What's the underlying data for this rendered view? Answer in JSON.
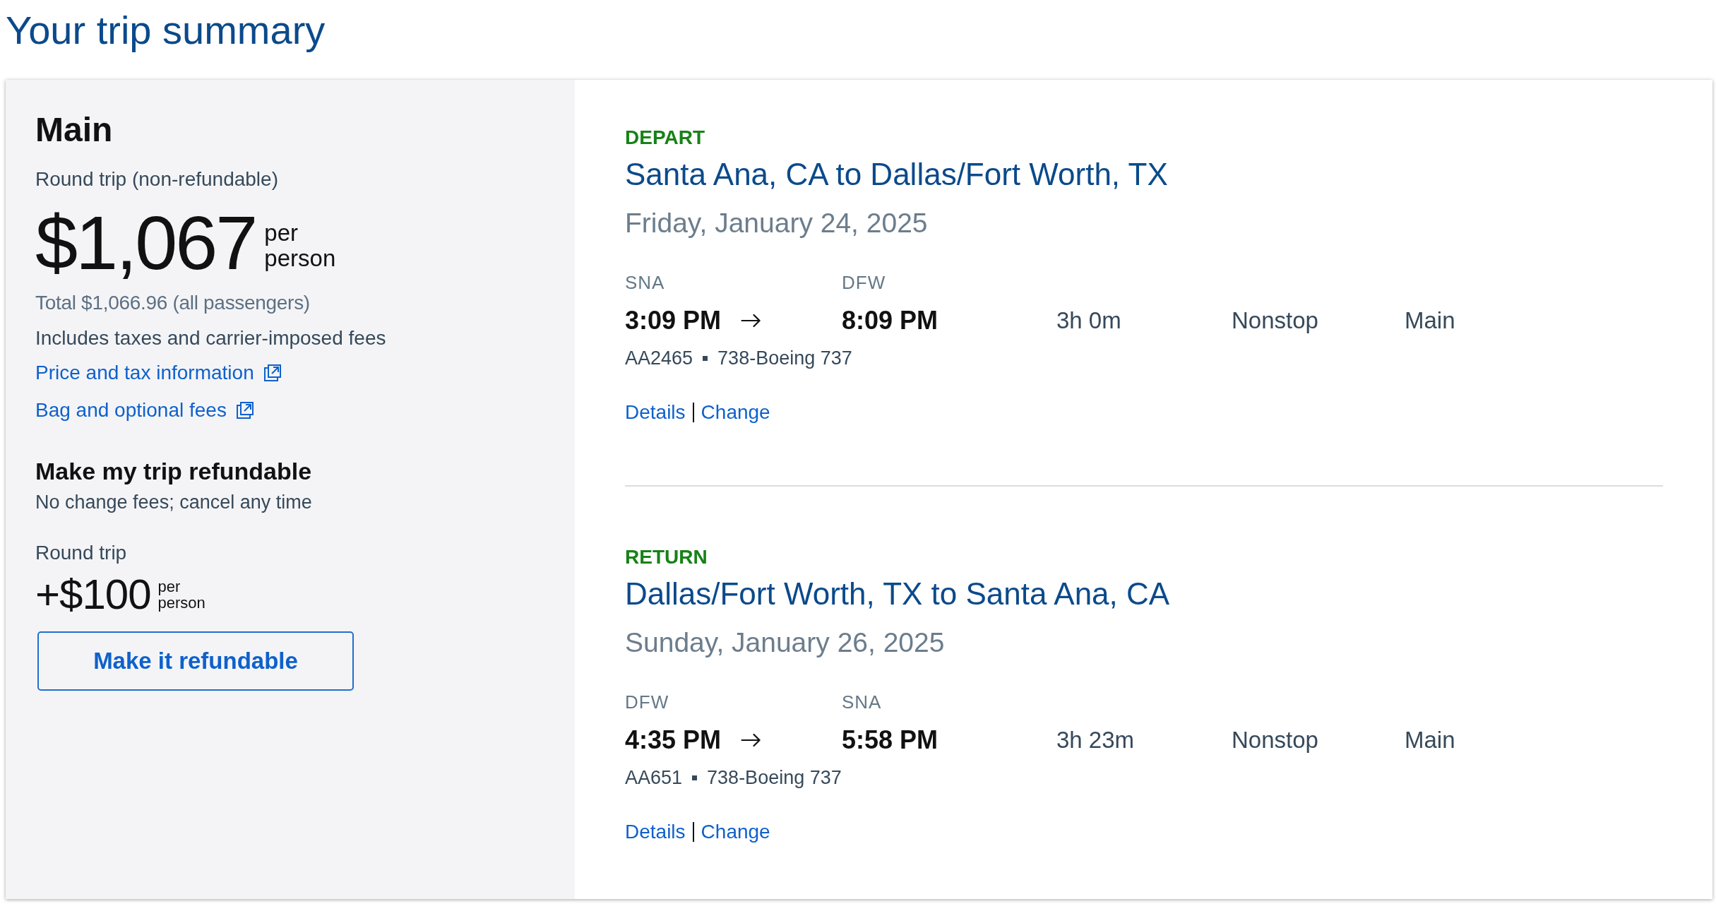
{
  "page_title": "Your trip summary",
  "fare": {
    "cabin": "Main",
    "trip_type": "Round trip (non-refundable)",
    "price": "$1,067",
    "price_unit": "per person",
    "total": "Total $1,066.96 (all passengers)",
    "fees_note": "Includes taxes and carrier-imposed fees",
    "links": [
      "Price and tax information",
      "Bag and optional fees"
    ]
  },
  "refund_offer": {
    "title": "Make my trip refundable",
    "subtitle": "No change fees; cancel any time",
    "trip_type": "Round trip",
    "price": "+$100",
    "price_unit": "per person",
    "button": "Make it refundable"
  },
  "flights": [
    {
      "direction": "DEPART",
      "route": "Santa Ana, CA to Dallas/Fort Worth, TX",
      "date": "Friday, January 24, 2025",
      "origin_code": "SNA",
      "departure_time": "3:09 PM",
      "destination_code": "DFW",
      "arrival_time": "8:09 PM",
      "duration": "3h 0m",
      "stops": "Nonstop",
      "cabin": "Main",
      "flight_number": "AA2465",
      "aircraft": "738-Boeing 737",
      "links": [
        "Details",
        "Change"
      ]
    },
    {
      "direction": "RETURN",
      "route": "Dallas/Fort Worth, TX to Santa Ana, CA",
      "date": "Sunday, January 26, 2025",
      "origin_code": "DFW",
      "departure_time": "4:35 PM",
      "destination_code": "SNA",
      "arrival_time": "5:58 PM",
      "duration": "3h 23m",
      "stops": "Nonstop",
      "cabin": "Main",
      "flight_number": "AA651",
      "aircraft": "738-Boeing 737",
      "links": [
        "Details",
        "Change"
      ]
    }
  ]
}
